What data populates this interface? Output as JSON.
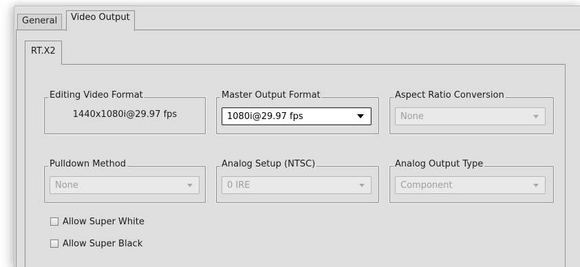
{
  "tabs": {
    "general": "General",
    "video_output": "Video Output"
  },
  "subtabs": {
    "rtx2": "RT.X2"
  },
  "groups": {
    "editing_video_format": {
      "title": "Editing Video Format",
      "value": "1440x1080i@29.97 fps"
    },
    "master_output_format": {
      "title": "Master Output Format",
      "value": "1080i@29.97 fps",
      "enabled": true
    },
    "aspect_ratio_conversion": {
      "title": "Aspect Ratio Conversion",
      "value": "None",
      "enabled": false
    },
    "pulldown_method": {
      "title": "Pulldown Method",
      "value": "None",
      "enabled": false
    },
    "analog_setup": {
      "title": "Analog Setup (NTSC)",
      "value": "0 IRE",
      "enabled": false
    },
    "analog_output_type": {
      "title": "Analog Output Type",
      "value": "Component",
      "enabled": false
    }
  },
  "checkboxes": {
    "allow_super_white": {
      "label": "Allow Super White",
      "checked": false
    },
    "allow_super_black": {
      "label": "Allow Super Black",
      "checked": false
    }
  }
}
